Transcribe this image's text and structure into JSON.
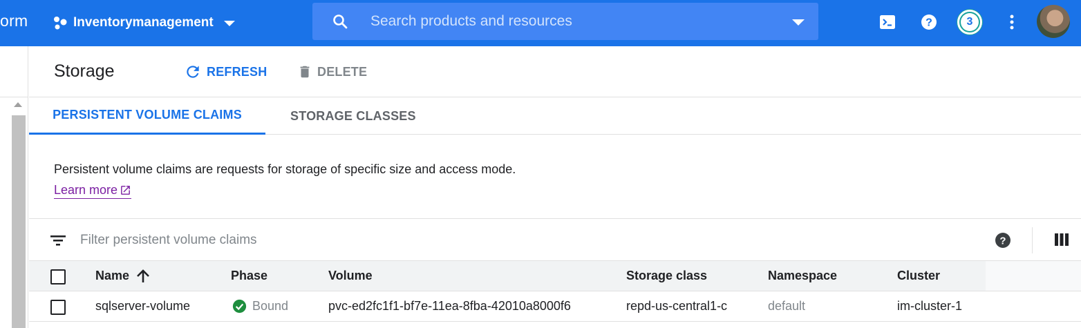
{
  "topbar": {
    "brand_fragment": "orm",
    "project_name": "Inventorymanagement",
    "search_placeholder": "Search products and resources",
    "notification_count": "3"
  },
  "header": {
    "title": "Storage",
    "refresh_label": "REFRESH",
    "delete_label": "DELETE"
  },
  "tabs": [
    {
      "label": "PERSISTENT VOLUME CLAIMS",
      "active": true
    },
    {
      "label": "STORAGE CLASSES",
      "active": false
    }
  ],
  "description": {
    "text": "Persistent volume claims are requests for storage of specific size and access mode.",
    "learn_more": "Learn more"
  },
  "filter": {
    "placeholder": "Filter persistent volume claims"
  },
  "table": {
    "columns": [
      "Name",
      "Phase",
      "Volume",
      "Storage class",
      "Namespace",
      "Cluster"
    ],
    "rows": [
      {
        "name": "sqlserver-volume",
        "phase": "Bound",
        "volume": "pvc-ed2fc1f1-bf7e-11ea-8fba-42010a8000f6",
        "storage_class": "repd-us-central1-c",
        "namespace": "default",
        "cluster": "im-cluster-1"
      }
    ]
  },
  "colors": {
    "primary": "#1a73e8",
    "status_ok": "#1e8e3e",
    "link_visited": "#7b1fa2",
    "muted": "#80868b"
  },
  "icons": [
    "project-dots-icon",
    "search-icon",
    "cloud-shell-icon",
    "help-icon",
    "more-vert-icon",
    "refresh-icon",
    "trash-icon",
    "external-link-icon",
    "filter-icon",
    "columns-icon",
    "sort-arrow-up-icon",
    "check-circle-icon"
  ]
}
